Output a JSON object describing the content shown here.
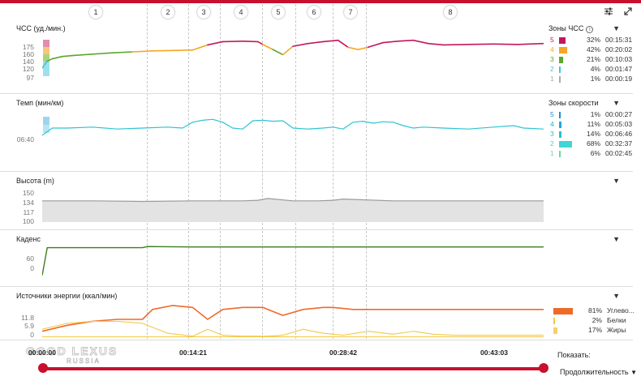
{
  "laps": [
    "1",
    "2",
    "3",
    "4",
    "5",
    "6",
    "7",
    "8"
  ],
  "panels": {
    "hr": {
      "title": "ЧСС (уд./мин.)",
      "ticks": [
        "175",
        "160",
        "140",
        "120",
        "97"
      ]
    },
    "pace": {
      "title": "Темп (мин/км)",
      "ticks": [
        "06:40"
      ]
    },
    "elevation": {
      "title": "Высота (m)",
      "ticks": [
        "150",
        "134",
        "117",
        "100"
      ]
    },
    "cadence": {
      "title": "Каденс",
      "ticks": [
        "60",
        "0"
      ]
    },
    "energy": {
      "title": "Источники энергии (ккал/мин)",
      "ticks": [
        "11.8",
        "5.9",
        "0"
      ]
    }
  },
  "hr_zones": {
    "title": "Зоны ЧСС",
    "rows": [
      {
        "n": "5",
        "pct": "32%",
        "time": "00:15:31",
        "color": "#c2185b",
        "frac": 0.32
      },
      {
        "n": "4",
        "pct": "42%",
        "time": "00:20:02",
        "color": "#f5a623",
        "frac": 0.42
      },
      {
        "n": "3",
        "pct": "21%",
        "time": "00:10:03",
        "color": "#5aa72e",
        "frac": 0.21
      },
      {
        "n": "2",
        "pct": "4%",
        "time": "00:01:47",
        "color": "#3fc4d9",
        "frac": 0.04
      },
      {
        "n": "1",
        "pct": "1%",
        "time": "00:00:19",
        "color": "#aaaaaa",
        "frac": 0.01
      }
    ]
  },
  "speed_zones": {
    "title": "Зоны скорости",
    "rows": [
      {
        "n": "5",
        "pct": "1%",
        "time": "00:00:27",
        "color": "#1b8fd1",
        "frac": 0.01
      },
      {
        "n": "4",
        "pct": "11%",
        "time": "00:05:03",
        "color": "#1fa6de",
        "frac": 0.11
      },
      {
        "n": "3",
        "pct": "14%",
        "time": "00:06:46",
        "color": "#2cbcd9",
        "frac": 0.14
      },
      {
        "n": "2",
        "pct": "68%",
        "time": "00:32:37",
        "color": "#3fd6d4",
        "frac": 0.68
      },
      {
        "n": "1",
        "pct": "6%",
        "time": "00:02:45",
        "color": "#6fd6a0",
        "frac": 0.06
      }
    ]
  },
  "energy_legend": [
    {
      "pct": "81%",
      "label": "Углево...",
      "color": "#ee6a2a",
      "frac": 0.81
    },
    {
      "pct": "2%",
      "label": "Белки",
      "color": "#f5c842",
      "frac": 0.02
    },
    {
      "pct": "17%",
      "label": "Жиры",
      "color": "#f5d06a",
      "frac": 0.17
    }
  ],
  "timeline": {
    "labels": [
      "00:00:00",
      "00:14:21",
      "00:28:42",
      "00:43:03"
    ],
    "show_label": "Показать:",
    "select_value": "Продолжительность"
  },
  "chart_data": [
    {
      "type": "line",
      "title": "ЧСС (уд./мин.)",
      "ylim": [
        90,
        195
      ],
      "x": [
        0,
        0.01,
        0.02,
        0.04,
        0.06,
        0.1,
        0.14,
        0.18,
        0.22,
        0.26,
        0.3,
        0.33,
        0.36,
        0.4,
        0.43,
        0.44,
        0.46,
        0.48,
        0.5,
        0.53,
        0.56,
        0.59,
        0.61,
        0.63,
        0.65,
        0.68,
        0.71,
        0.74,
        0.77,
        0.8,
        0.85,
        0.9,
        0.95,
        1.0
      ],
      "y": [
        125,
        140,
        145,
        150,
        152,
        155,
        158,
        160,
        162,
        163,
        164,
        175,
        182,
        183,
        182,
        176,
        165,
        154,
        172,
        178,
        182,
        185,
        170,
        165,
        170,
        180,
        183,
        185,
        178,
        175,
        176,
        177,
        176,
        178
      ]
    },
    {
      "type": "line",
      "title": "Темп (мин/км)",
      "ylim": [
        0,
        1
      ],
      "x": [
        0,
        0.02,
        0.05,
        0.1,
        0.15,
        0.2,
        0.25,
        0.28,
        0.3,
        0.32,
        0.34,
        0.36,
        0.38,
        0.4,
        0.42,
        0.44,
        0.46,
        0.48,
        0.5,
        0.53,
        0.56,
        0.58,
        0.6,
        0.62,
        0.64,
        0.66,
        0.68,
        0.7,
        0.72,
        0.74,
        0.76,
        0.8,
        0.85,
        0.9,
        0.94,
        0.96,
        1.0
      ],
      "y": [
        0.55,
        0.7,
        0.7,
        0.72,
        0.68,
        0.7,
        0.72,
        0.7,
        0.82,
        0.86,
        0.88,
        0.82,
        0.7,
        0.68,
        0.85,
        0.86,
        0.84,
        0.85,
        0.7,
        0.68,
        0.7,
        0.72,
        0.68,
        0.82,
        0.84,
        0.8,
        0.83,
        0.82,
        0.75,
        0.7,
        0.72,
        0.7,
        0.68,
        0.72,
        0.75,
        0.7,
        0.68
      ]
    },
    {
      "type": "area",
      "title": "Высота (m)",
      "ylim": [
        100,
        155
      ],
      "x": [
        0,
        0.1,
        0.2,
        0.3,
        0.4,
        0.43,
        0.45,
        0.5,
        0.55,
        0.58,
        0.6,
        0.7,
        0.8,
        0.9,
        1.0
      ],
      "y": [
        136,
        136,
        135,
        136,
        136,
        137,
        140,
        136,
        136,
        137,
        139,
        136,
        136,
        136,
        136
      ]
    },
    {
      "type": "line",
      "title": "Каденс",
      "ylim": [
        0,
        90
      ],
      "x": [
        0,
        0.01,
        0.1,
        0.2,
        0.21,
        0.3,
        0.4,
        0.5,
        0.6,
        0.7,
        0.8,
        0.9,
        1.0
      ],
      "y": [
        5,
        82,
        82,
        82,
        85,
        84,
        84,
        84,
        84,
        84,
        84,
        84,
        84
      ]
    },
    {
      "type": "line",
      "title": "Источники энергии (ккал/мин)",
      "ylim": [
        0,
        18
      ],
      "series": [
        {
          "name": "Углево...",
          "x": [
            0,
            0.05,
            0.1,
            0.15,
            0.2,
            0.22,
            0.26,
            0.3,
            0.33,
            0.36,
            0.4,
            0.44,
            0.46,
            0.48,
            0.52,
            0.56,
            0.58,
            0.62,
            0.66,
            0.7,
            0.8,
            0.9,
            1.0
          ],
          "y": [
            3,
            6,
            8,
            9,
            9,
            14,
            16,
            15,
            9,
            14,
            15,
            15,
            13,
            11,
            14,
            15,
            15,
            14,
            14,
            14,
            14,
            14,
            14
          ]
        },
        {
          "name": "Белки",
          "x": [
            0,
            0.2,
            0.4,
            0.6,
            0.8,
            1.0
          ],
          "y": [
            0.2,
            0.2,
            0.2,
            0.2,
            0.2,
            0.2
          ]
        },
        {
          "name": "Жиры",
          "x": [
            0,
            0.05,
            0.1,
            0.15,
            0.2,
            0.25,
            0.3,
            0.33,
            0.36,
            0.4,
            0.45,
            0.48,
            0.52,
            0.56,
            0.6,
            0.65,
            0.7,
            0.74,
            0.78,
            0.82,
            0.9,
            1.0
          ],
          "y": [
            4,
            7,
            8,
            8,
            7,
            2,
            0.5,
            4,
            1,
            0.5,
            0.5,
            1,
            4,
            2,
            1,
            3,
            1.5,
            3,
            1.5,
            1,
            1,
            1
          ]
        }
      ]
    }
  ]
}
